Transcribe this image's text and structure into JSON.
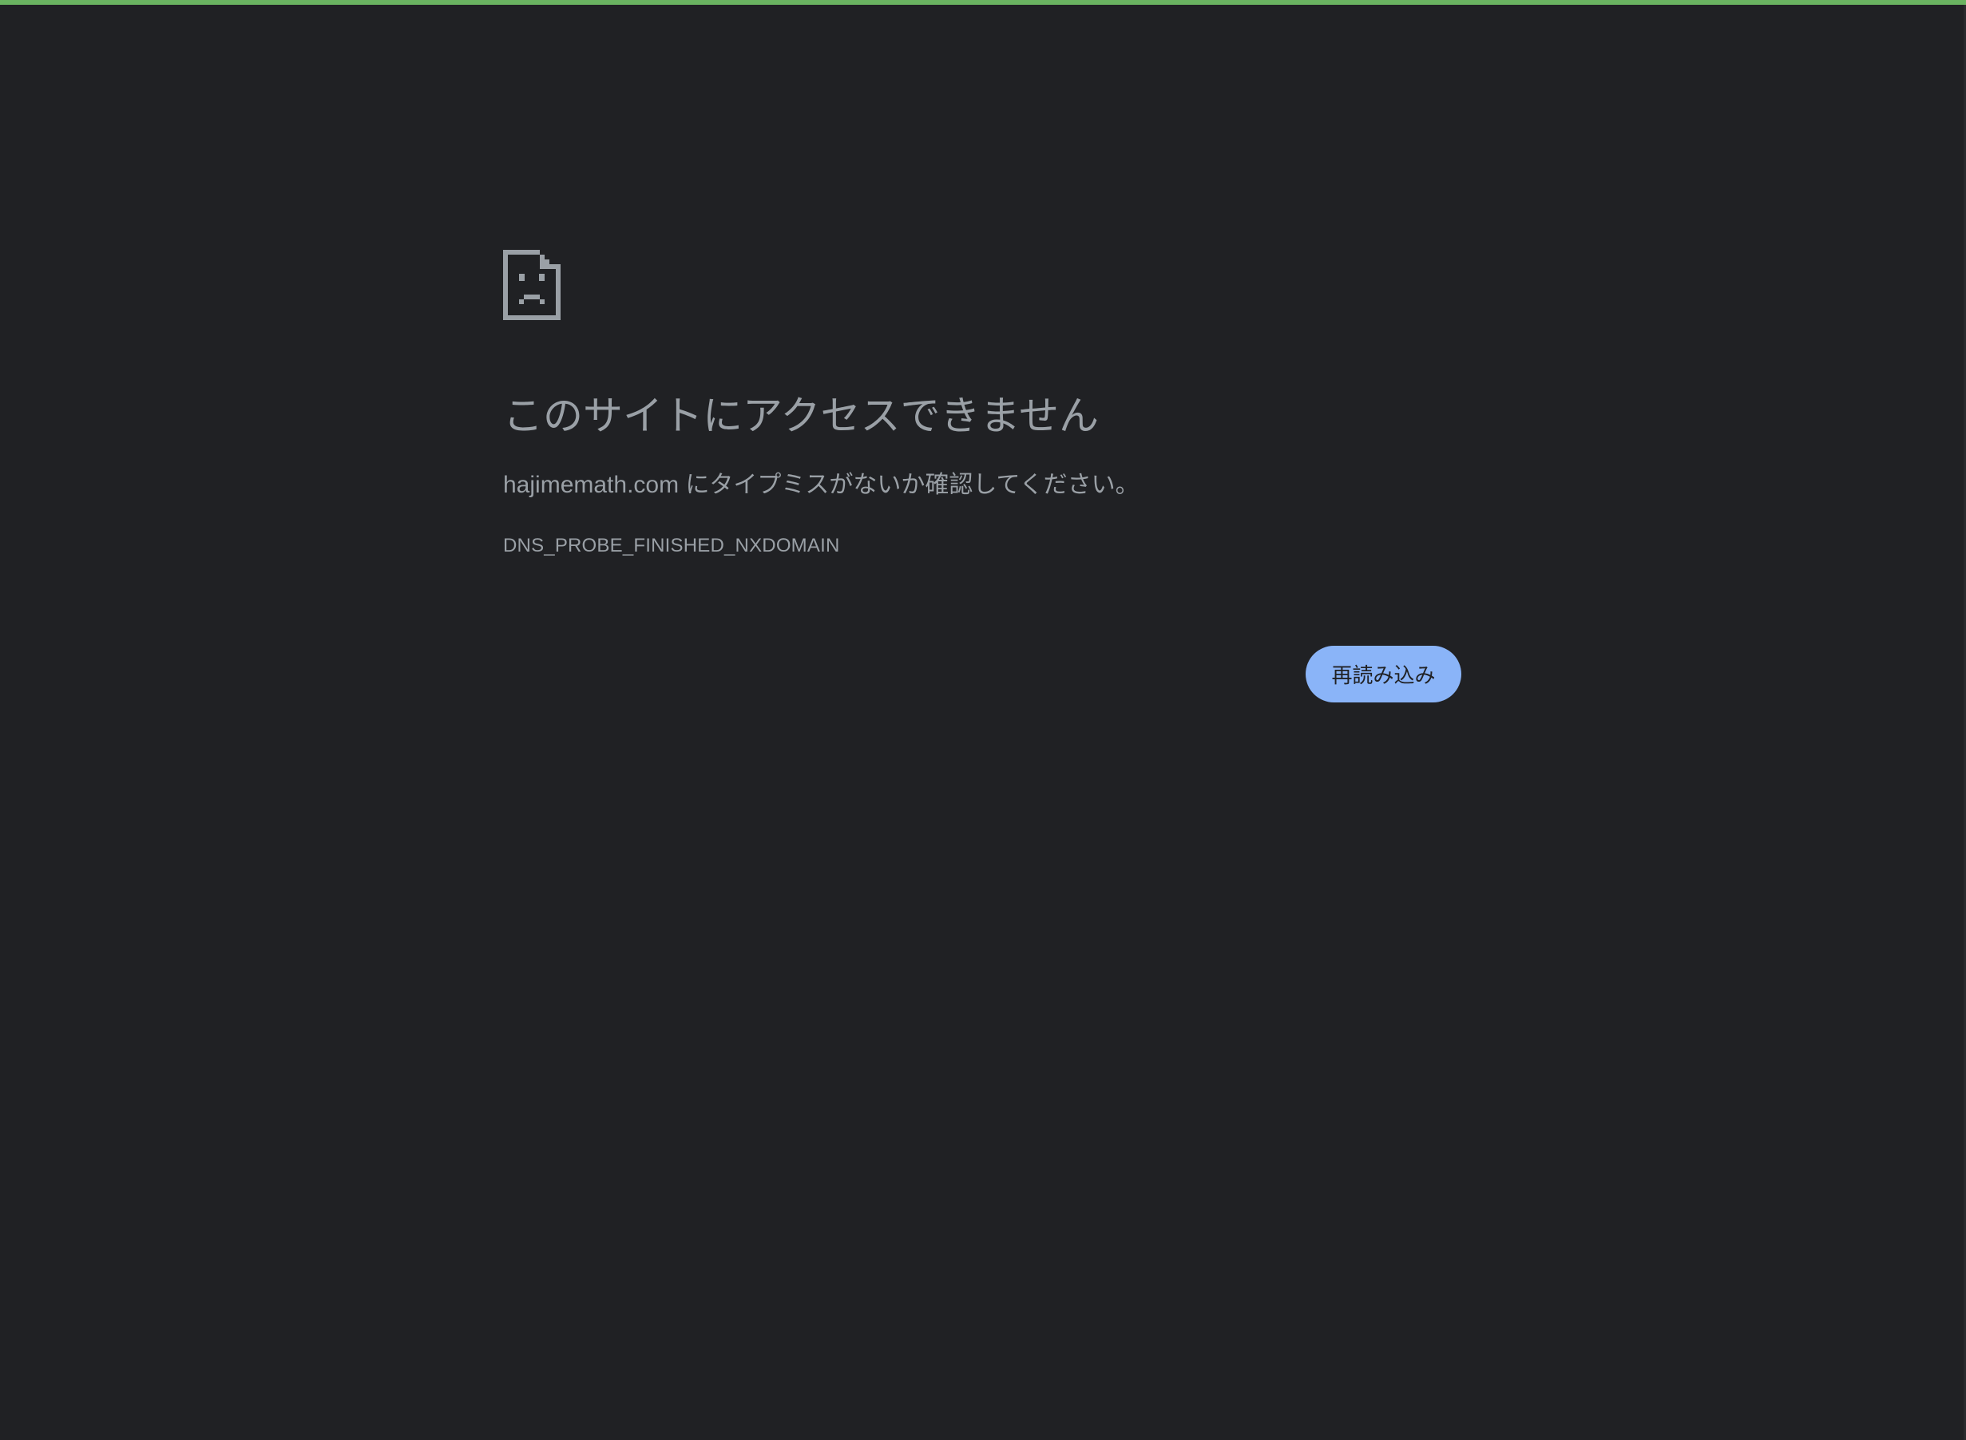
{
  "page": {
    "heading": "このサイトにアクセスできません",
    "message": "hajimemath.com にタイプミスがないか確認してください。",
    "error_code": "DNS_PROBE_FINISHED_NXDOMAIN",
    "reload_label": "再読み込み",
    "icon": "sad-page-icon"
  },
  "colors": {
    "background": "#202124",
    "accent": "#6ab361",
    "text": "#9aa0a6",
    "button": "#8ab4f8",
    "button_text": "#202124"
  }
}
